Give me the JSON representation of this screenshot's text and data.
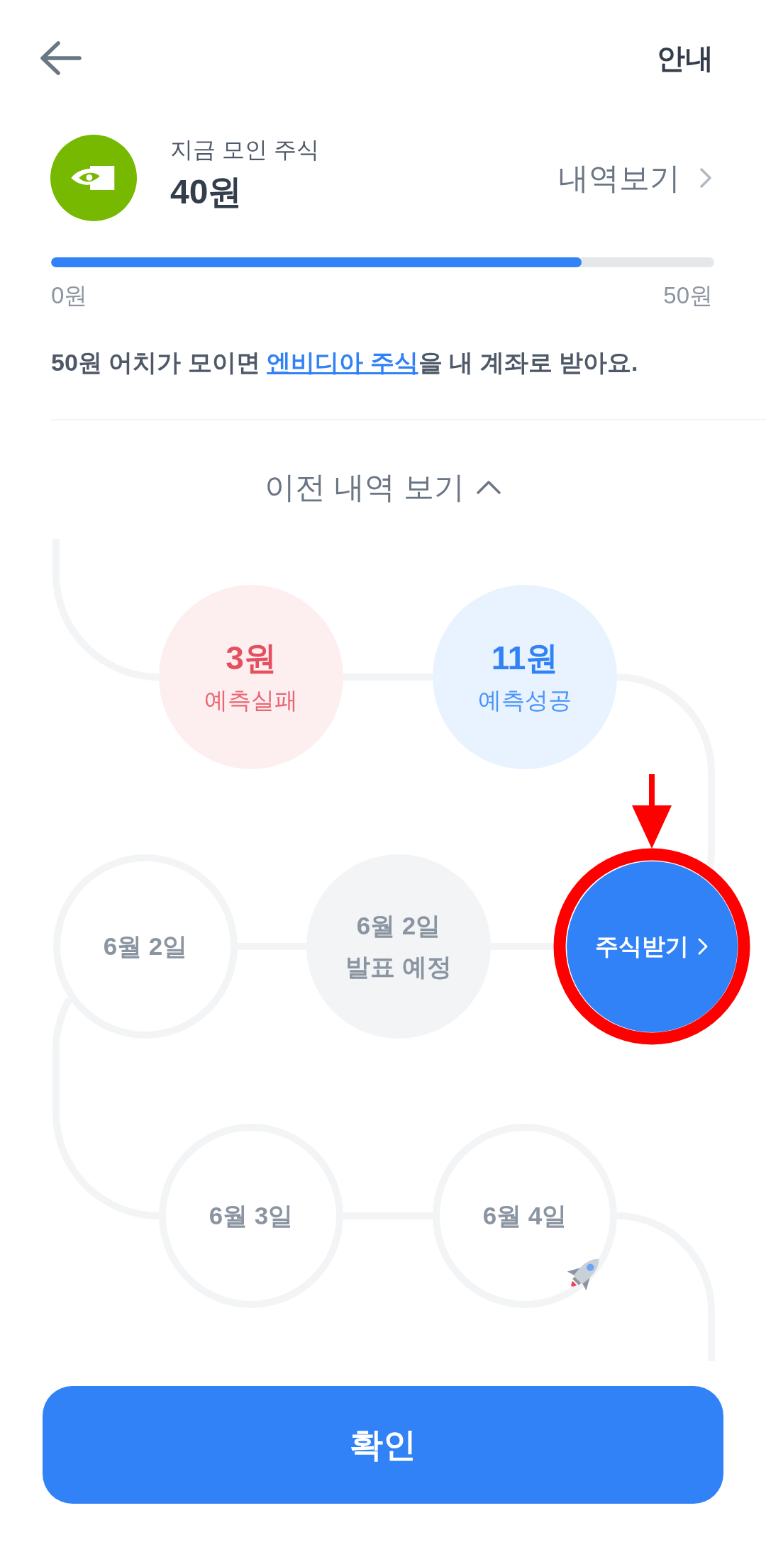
{
  "header": {
    "guide_button": "안내"
  },
  "stock": {
    "caption": "지금 모인 주식",
    "amount": "40원",
    "history_link": "내역보기"
  },
  "progress": {
    "level": 0.8,
    "min_label": "0원",
    "max_label": "50원"
  },
  "notice": {
    "before": "50원 어치가 모이면 ",
    "link": "엔비디아 주식",
    "after": "을 내 계좌로 받아요."
  },
  "history_toggle": {
    "label": "이전 내역 보기",
    "expanded": true
  },
  "timeline": {
    "rows": [
      [
        {
          "kind": "fail",
          "amount": "3원",
          "label": "예측실패",
          "highlighted": false,
          "current": false
        },
        {
          "kind": "success",
          "amount": "11원",
          "label": "예측성공",
          "highlighted": false,
          "current": false
        }
      ],
      [
        {
          "kind": "date",
          "label": "6월 2일",
          "highlighted": false,
          "current": false
        },
        {
          "kind": "pending",
          "label": "6월 2일",
          "sublabel": "발표 예정",
          "highlighted": false,
          "current": false
        },
        {
          "kind": "action",
          "label": "주식받기",
          "highlighted": true,
          "current": false
        }
      ],
      [
        {
          "kind": "date",
          "label": "6월 3일",
          "highlighted": false,
          "current": false
        },
        {
          "kind": "date",
          "label": "6월 4일",
          "highlighted": false,
          "current": true
        }
      ]
    ]
  },
  "confirm_button": "확인"
}
